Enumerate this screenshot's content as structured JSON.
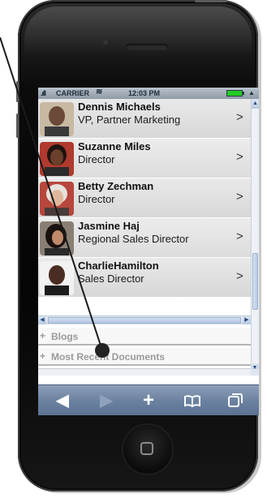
{
  "status_bar": {
    "carrier": "CARRIER",
    "time": "12:03 PM"
  },
  "contacts": [
    {
      "name": "Dennis Michaels",
      "title": "VP, Partner Marketing",
      "avatar_color": "#6b4a3a"
    },
    {
      "name": "Suzanne Miles",
      "title": "Director",
      "avatar_color": "#3b2418"
    },
    {
      "name": "Betty Zechman",
      "title": "Director",
      "avatar_color": "#c9b39a"
    },
    {
      "name": "Jasmine Haj",
      "title": "Regional Sales Director",
      "avatar_color": "#2e1f1a"
    },
    {
      "name": "CharlieHamilton",
      "title": "Sales Director",
      "avatar_color": "#4a2d22"
    }
  ],
  "row_chevron": ">",
  "sections": {
    "blogs": {
      "icon": "+",
      "label": "Blogs"
    },
    "documents": {
      "icon": "+",
      "label": "Most Recent Documents"
    }
  },
  "toolbar": {
    "back_icon": "back-arrow-icon",
    "forward_icon": "forward-arrow-icon",
    "add_icon": "plus-icon",
    "bookmarks_icon": "book-icon",
    "pages_icon": "pages-icon"
  },
  "colors": {
    "toolbar": "#6b82a1",
    "status_bar": "#9aa6b2",
    "row_background": "#dcdcdc"
  }
}
